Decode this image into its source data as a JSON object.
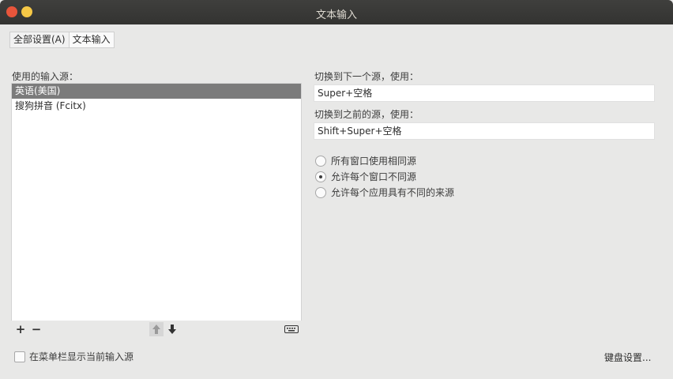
{
  "window": {
    "title": "文本输入"
  },
  "breadcrumb": {
    "items": [
      "全部设置(A)",
      "文本输入"
    ]
  },
  "sources": {
    "heading": "使用的输入源：",
    "items": [
      {
        "label": "英语(美国)",
        "selected": true
      },
      {
        "label": "搜狗拼音 (Fcitx)",
        "selected": false
      }
    ],
    "toolbar": {
      "add": "+",
      "remove": "−",
      "up": "🡅",
      "down": "🡇",
      "keyboard_icon": "keyboard-icon"
    }
  },
  "switching": {
    "next_label": "切换到下一个源，使用：",
    "next_value": "Super+空格",
    "prev_label": "切换到之前的源，使用：",
    "prev_value": "Shift+Super+空格"
  },
  "modes": {
    "options": [
      {
        "label": "所有窗口使用相同源",
        "checked": false
      },
      {
        "label": "允许每个窗口不同源",
        "checked": true
      },
      {
        "label": "允许每个应用具有不同的来源",
        "checked": false
      }
    ]
  },
  "footer": {
    "show_in_menu_label": "在菜单栏显示当前输入源",
    "keyboard_settings_label": "键盘设置..."
  },
  "colors": {
    "titlebar": "#3a3a38",
    "close": "#e8553b",
    "minimize": "#f6c846",
    "selection": "#7b7b7b",
    "window_bg": "#e8e8e7"
  }
}
